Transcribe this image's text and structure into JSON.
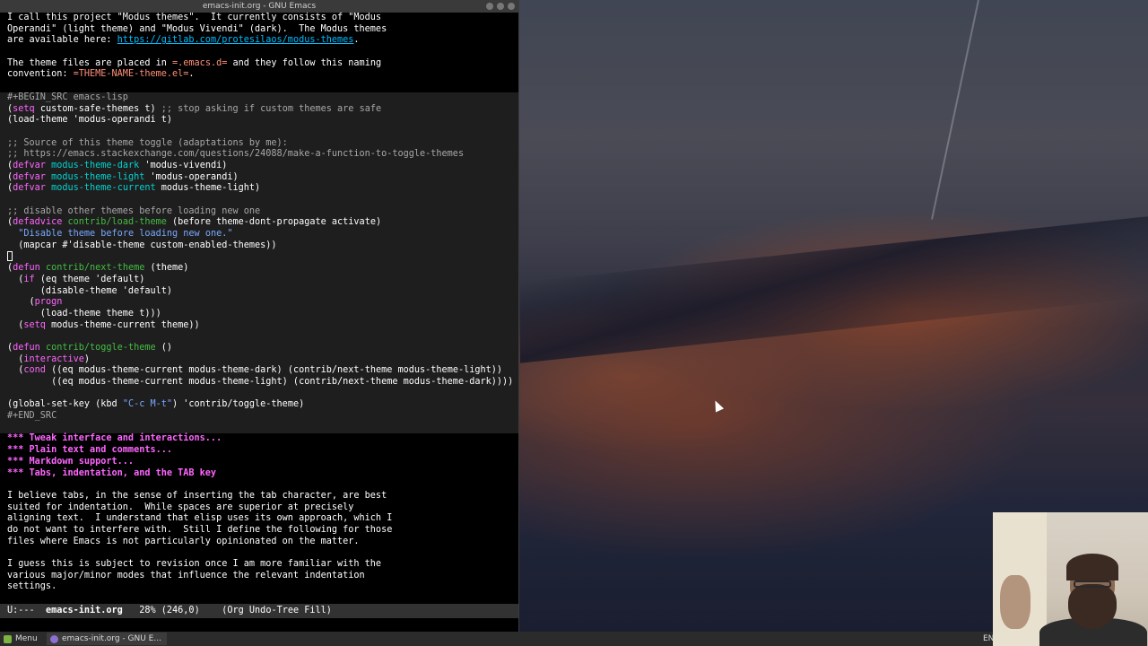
{
  "window": {
    "title": "emacs-init.org - GNU Emacs"
  },
  "buffer": {
    "lines": [
      [
        [
          "",
          "I call this project \"Modus themes\".  It currently consists of \"Modus"
        ]
      ],
      [
        [
          "",
          "Operandi\" (light theme) and \"Modus Vivendi\" (dark).  The Modus themes"
        ]
      ],
      [
        [
          "",
          "are available here: "
        ],
        [
          "link",
          "https://gitlab.com/protesilaos/modus-themes"
        ],
        [
          "",
          "."
        ]
      ],
      [
        [
          "",
          ""
        ]
      ],
      [
        [
          "",
          "The theme files are placed in "
        ],
        [
          "verb",
          "=.emacs.d="
        ],
        [
          "",
          " and they follow this naming"
        ]
      ],
      [
        [
          "",
          "convention: "
        ],
        [
          "verb",
          "=THEME-NAME-theme.el="
        ],
        [
          "",
          "."
        ]
      ],
      [
        [
          "",
          ""
        ]
      ],
      [
        [
          "meta",
          "#+BEGIN_SRC emacs-lisp"
        ]
      ],
      [
        [
          "",
          "("
        ],
        [
          "kw",
          "setq"
        ],
        [
          "",
          " custom-safe-themes t) "
        ],
        [
          "cm",
          ";; stop asking if custom themes are safe"
        ]
      ],
      [
        [
          "",
          "(load-theme 'modus-operandi t)"
        ]
      ],
      [
        [
          "",
          ""
        ]
      ],
      [
        [
          "cm",
          ";; Source of this theme toggle (adaptations by me):"
        ]
      ],
      [
        [
          "cm",
          ";; https://emacs.stackexchange.com/questions/24088/make-a-function-to-toggle-themes"
        ]
      ],
      [
        [
          "",
          "("
        ],
        [
          "kw",
          "defvar"
        ],
        [
          "",
          " "
        ],
        [
          "var",
          "modus-theme-dark"
        ],
        [
          "",
          " 'modus-vivendi)"
        ]
      ],
      [
        [
          "",
          "("
        ],
        [
          "kw",
          "defvar"
        ],
        [
          "",
          " "
        ],
        [
          "var",
          "modus-theme-light"
        ],
        [
          "",
          " 'modus-operandi)"
        ]
      ],
      [
        [
          "",
          "("
        ],
        [
          "kw",
          "defvar"
        ],
        [
          "",
          " "
        ],
        [
          "var",
          "modus-theme-current"
        ],
        [
          "",
          " modus-theme-light)"
        ]
      ],
      [
        [
          "",
          ""
        ]
      ],
      [
        [
          "cm",
          ";; disable other themes before loading new one"
        ]
      ],
      [
        [
          "",
          "("
        ],
        [
          "kw",
          "defadvice"
        ],
        [
          "",
          " "
        ],
        [
          "fn",
          "contrib/load-theme"
        ],
        [
          "",
          " (before theme-dont-propagate activate)"
        ]
      ],
      [
        [
          "",
          "  "
        ],
        [
          "str",
          "\"Disable theme before loading new one.\""
        ]
      ],
      [
        [
          "",
          "  (mapcar #'disable-theme custom-enabled-themes))"
        ]
      ],
      [
        [
          "cursor",
          ""
        ]
      ],
      [
        [
          "",
          "("
        ],
        [
          "kw",
          "defun"
        ],
        [
          "",
          " "
        ],
        [
          "fn",
          "contrib/next-theme"
        ],
        [
          "",
          " (theme)"
        ]
      ],
      [
        [
          "",
          "  ("
        ],
        [
          "kw",
          "if"
        ],
        [
          "",
          " (eq theme 'default)"
        ]
      ],
      [
        [
          "",
          "      (disable-theme 'default)"
        ]
      ],
      [
        [
          "",
          "    ("
        ],
        [
          "kw",
          "progn"
        ]
      ],
      [
        [
          "",
          "      (load-theme theme t)))"
        ]
      ],
      [
        [
          "",
          "  ("
        ],
        [
          "kw",
          "setq"
        ],
        [
          "",
          " modus-theme-current theme))"
        ]
      ],
      [
        [
          "",
          ""
        ]
      ],
      [
        [
          "",
          "("
        ],
        [
          "kw",
          "defun"
        ],
        [
          "",
          " "
        ],
        [
          "fn",
          "contrib/toggle-theme"
        ],
        [
          "",
          " ()"
        ]
      ],
      [
        [
          "",
          "  ("
        ],
        [
          "kw",
          "interactive"
        ],
        [
          "",
          ")"
        ]
      ],
      [
        [
          "",
          "  ("
        ],
        [
          "kw",
          "cond"
        ],
        [
          "",
          " ((eq modus-theme-current modus-theme-dark) (contrib/next-theme modus-theme-light))"
        ]
      ],
      [
        [
          "",
          "        ((eq modus-theme-current modus-theme-light) (contrib/next-theme modus-theme-dark))))"
        ]
      ],
      [
        [
          "",
          ""
        ]
      ],
      [
        [
          "",
          "(global-set-key (kbd "
        ],
        [
          "str",
          "\"C-c M-t\""
        ],
        [
          "",
          ") 'contrib/toggle-theme)"
        ]
      ],
      [
        [
          "meta",
          "#+END_SRC"
        ]
      ],
      [
        [
          "",
          ""
        ]
      ],
      [
        [
          "head",
          "*** Tweak interface and interactions..."
        ]
      ],
      [
        [
          "head",
          "*** Plain text and comments..."
        ]
      ],
      [
        [
          "head",
          "*** Markdown support..."
        ]
      ],
      [
        [
          "head",
          "*** Tabs, indentation, and the TAB key"
        ]
      ],
      [
        [
          "",
          ""
        ]
      ],
      [
        [
          "",
          "I believe tabs, in the sense of inserting the tab character, are best"
        ]
      ],
      [
        [
          "",
          "suited for indentation.  While spaces are superior at precisely"
        ]
      ],
      [
        [
          "",
          "aligning text.  I understand that elisp uses its own approach, which I"
        ]
      ],
      [
        [
          "",
          "do not want to interfere with.  Still I define the following for those"
        ]
      ],
      [
        [
          "",
          "files where Emacs is not particularly opinionated on the matter."
        ]
      ],
      [
        [
          "",
          ""
        ]
      ],
      [
        [
          "",
          "I guess this is subject to revision once I am more familiar with the"
        ]
      ],
      [
        [
          "",
          "various major/minor modes that influence the relevant indentation"
        ]
      ],
      [
        [
          "",
          "settings."
        ]
      ]
    ],
    "block_rows": [
      7,
      36
    ]
  },
  "modeline": {
    "status": "U:---",
    "buffer_name": "emacs-init.org",
    "position": "28% (246,0)",
    "modes": "(Org Undo-Tree Fill)"
  },
  "taskbar": {
    "menu_label": "Menu",
    "emacs_task": "emacs-init.org - GNU E...",
    "tray_text": "EN"
  },
  "colors": {
    "keyword": "#ff66ff",
    "function": "#44bc44",
    "string": "#79a8ff",
    "comment": "#a8a8a8",
    "variable": "#00d3d0",
    "link": "#00bcff",
    "verbatim": "#ff9077",
    "heading": "#ff66ff"
  }
}
